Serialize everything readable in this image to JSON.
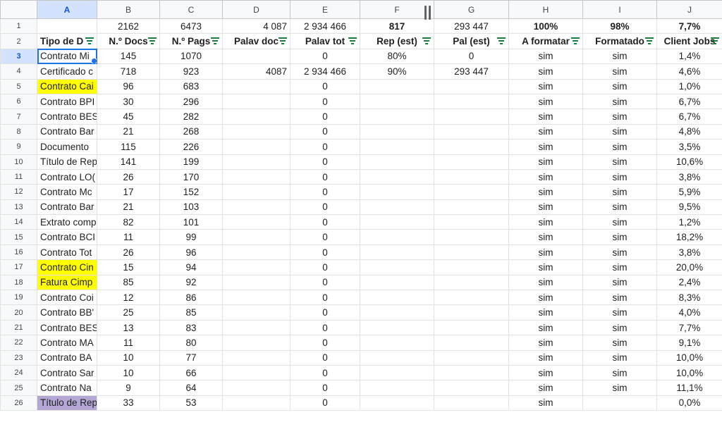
{
  "columns": [
    "A",
    "B",
    "C",
    "D",
    "E",
    "F",
    "G",
    "H",
    "I",
    "J"
  ],
  "selected_column": "A",
  "selected_row": "3",
  "summary_row": {
    "num": "1",
    "cells": [
      "",
      "2162",
      "6473",
      "4 087",
      "2 934 466",
      "817",
      "293 447",
      "100%",
      "98%",
      "7,7%"
    ]
  },
  "header_row": {
    "num": "2",
    "cells": [
      "Tipo de D",
      "N.º Docs",
      "N.º Pags",
      "Palav doc",
      "Palav tot",
      "Rep (est)",
      "Pal (est)",
      "A formatar",
      "Formatado",
      "Client Jobs"
    ]
  },
  "rows": [
    {
      "num": "3",
      "cells": [
        "Contrato Mi",
        "145",
        "1070",
        "",
        "0",
        "80%",
        "0",
        "sim",
        "sim",
        "1,4%"
      ]
    },
    {
      "num": "4",
      "cells": [
        "Certificado c",
        "718",
        "923",
        "4087",
        "2 934 466",
        "90%",
        "293 447",
        "sim",
        "sim",
        "4,6%"
      ]
    },
    {
      "num": "5",
      "cells": [
        "Contrato Cai",
        "96",
        "683",
        "",
        "0",
        "",
        "",
        "sim",
        "sim",
        "1,0%"
      ]
    },
    {
      "num": "6",
      "cells": [
        "Contrato BPI",
        "30",
        "296",
        "",
        "0",
        "",
        "",
        "sim",
        "sim",
        "6,7%"
      ]
    },
    {
      "num": "7",
      "cells": [
        "Contrato BES",
        "45",
        "282",
        "",
        "0",
        "",
        "",
        "sim",
        "sim",
        "6,7%"
      ]
    },
    {
      "num": "8",
      "cells": [
        "Contrato Bar",
        "21",
        "268",
        "",
        "0",
        "",
        "",
        "sim",
        "sim",
        "4,8%"
      ]
    },
    {
      "num": "9",
      "cells": [
        "Documento",
        "115",
        "226",
        "",
        "0",
        "",
        "",
        "sim",
        "sim",
        "3,5%"
      ]
    },
    {
      "num": "10",
      "cells": [
        "Título de Rep",
        "141",
        "199",
        "",
        "0",
        "",
        "",
        "sim",
        "sim",
        "10,6%"
      ]
    },
    {
      "num": "11",
      "cells": [
        "Contrato LO(",
        "26",
        "170",
        "",
        "0",
        "",
        "",
        "sim",
        "sim",
        "3,8%"
      ]
    },
    {
      "num": "12",
      "cells": [
        "Contrato Mc",
        "17",
        "152",
        "",
        "0",
        "",
        "",
        "sim",
        "sim",
        "5,9%"
      ]
    },
    {
      "num": "13",
      "cells": [
        "Contrato Bar",
        "21",
        "103",
        "",
        "0",
        "",
        "",
        "sim",
        "sim",
        "9,5%"
      ]
    },
    {
      "num": "14",
      "cells": [
        "Extrato comp",
        "82",
        "101",
        "",
        "0",
        "",
        "",
        "sim",
        "sim",
        "1,2%"
      ]
    },
    {
      "num": "15",
      "cells": [
        "Contrato BCI",
        "11",
        "99",
        "",
        "0",
        "",
        "",
        "sim",
        "sim",
        "18,2%"
      ]
    },
    {
      "num": "16",
      "cells": [
        "Contrato Tot",
        "26",
        "96",
        "",
        "0",
        "",
        "",
        "sim",
        "sim",
        "3,8%"
      ]
    },
    {
      "num": "17",
      "cells": [
        "Contrato Cin",
        "15",
        "94",
        "",
        "0",
        "",
        "",
        "sim",
        "sim",
        "20,0%"
      ]
    },
    {
      "num": "18",
      "cells": [
        "Fatura Cimp",
        "85",
        "92",
        "",
        "0",
        "",
        "",
        "sim",
        "sim",
        "2,4%"
      ]
    },
    {
      "num": "19",
      "cells": [
        "Contrato Coi",
        "12",
        "86",
        "",
        "0",
        "",
        "",
        "sim",
        "sim",
        "8,3%"
      ]
    },
    {
      "num": "20",
      "cells": [
        "Contrato BB'",
        "25",
        "85",
        "",
        "0",
        "",
        "",
        "sim",
        "sim",
        "4,0%"
      ]
    },
    {
      "num": "21",
      "cells": [
        "Contrato BES",
        "13",
        "83",
        "",
        "0",
        "",
        "",
        "sim",
        "sim",
        "7,7%"
      ]
    },
    {
      "num": "22",
      "cells": [
        "Contrato MA",
        "11",
        "80",
        "",
        "0",
        "",
        "",
        "sim",
        "sim",
        "9,1%"
      ]
    },
    {
      "num": "23",
      "cells": [
        "Contrato BA",
        "10",
        "77",
        "",
        "0",
        "",
        "",
        "sim",
        "sim",
        "10,0%"
      ]
    },
    {
      "num": "24",
      "cells": [
        "Contrato Sar",
        "10",
        "66",
        "",
        "0",
        "",
        "",
        "sim",
        "sim",
        "10,0%"
      ]
    },
    {
      "num": "25",
      "cells": [
        "Contrato Na",
        "9",
        "64",
        "",
        "0",
        "",
        "",
        "sim",
        "sim",
        "11,1%"
      ]
    },
    {
      "num": "26",
      "cells": [
        "Título de Rep",
        "33",
        "53",
        "",
        "0",
        "",
        "",
        "sim",
        "",
        "0,0%"
      ]
    }
  ],
  "highlight_colors": {
    "yellow": "#ffff00",
    "purple": "#b4a7d6",
    "selection": "#1a73e8",
    "filter": "#188038"
  },
  "highlighted_rows": {
    "5": "yellow",
    "17": "yellow",
    "18": "yellow",
    "26": "purple"
  }
}
